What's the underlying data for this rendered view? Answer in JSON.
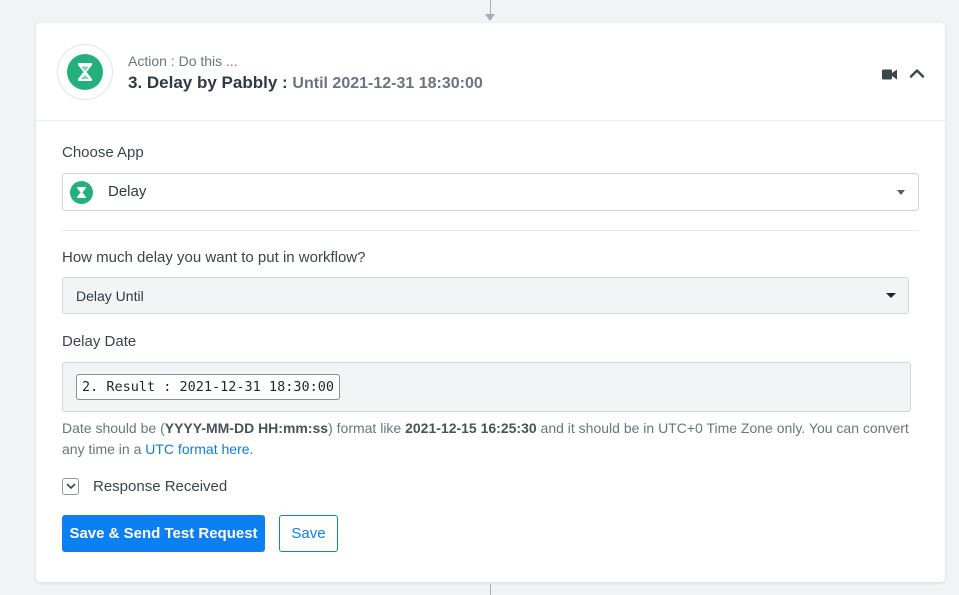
{
  "header": {
    "subtitle": "Action : Do this ...",
    "title": "3. Delay by Pabbly :",
    "title_suffix": "Until 2021-12-31 18:30:00"
  },
  "choose_app": {
    "label": "Choose App",
    "selected": "Delay"
  },
  "delay_type": {
    "label": "How much delay you want to put in workflow?",
    "selected": "Delay Until"
  },
  "delay_date": {
    "label": "Delay Date",
    "token": "2. Result : 2021-12-31 18:30:00",
    "help": {
      "part1": "Date should be (",
      "format": "YYYY-MM-DD HH:mm:ss",
      "part2": ") format like ",
      "example": "2021-12-15 16:25:30",
      "part3": " and it should be in UTC+0 Time Zone only. You can convert any time in a ",
      "link": "UTC format here."
    }
  },
  "response": {
    "label": "Response Received"
  },
  "actions": {
    "save_test": "Save & Send Test Request",
    "save": "Save"
  },
  "icons": {
    "app_logo": "hourglass-icon",
    "video": "video-camera-icon",
    "collapse": "chevron-up-icon",
    "toggle": "chevron-down-icon"
  },
  "colors": {
    "brand_green": "#23b07d",
    "primary_blue": "#0c7ff2",
    "link_blue": "#0c7fdc",
    "page_bg": "#f1f3f5"
  }
}
